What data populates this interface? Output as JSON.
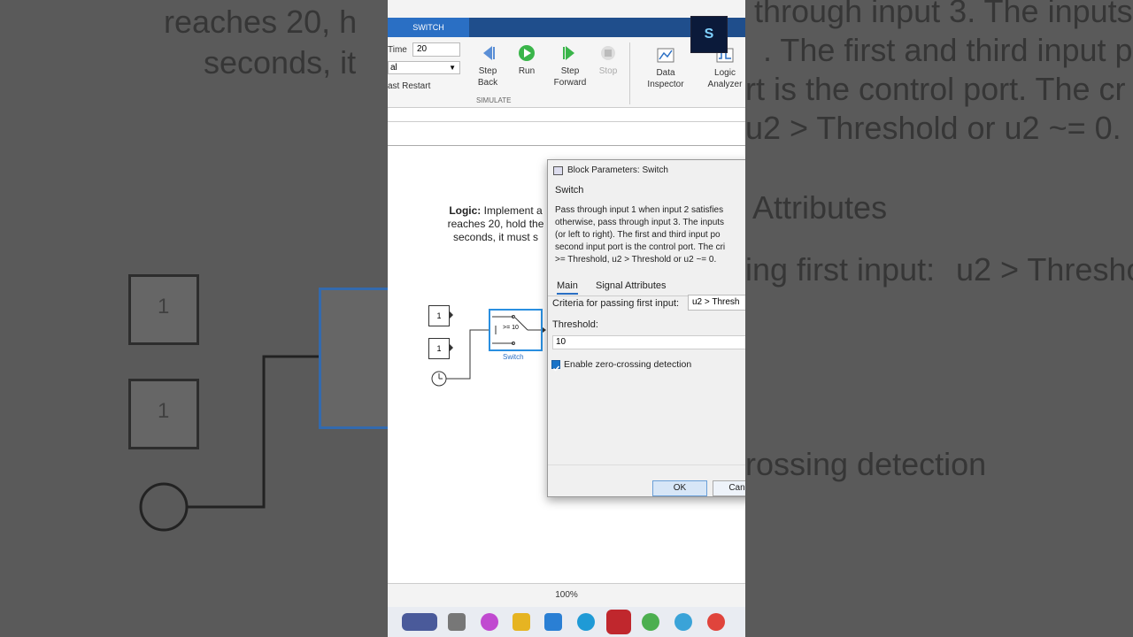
{
  "background": {
    "left_text": [
      "reaches 20, h",
      "seconds, it"
    ],
    "left_blocks": [
      "1",
      "1"
    ],
    "right_text": [
      "through input 3. The inputs",
      ". The first and third input po",
      "rt is the control port. The cr",
      "u2 > Threshold or u2 ~= 0."
    ],
    "right_tab": "Attributes",
    "right_criteria_label": "ing first input:",
    "right_criteria_value": "u2 > Thresho",
    "right_check": "rossing detection"
  },
  "ribbon": {
    "tab_label": "SWITCH",
    "stop_time_label": "Time",
    "stop_time_value": "20",
    "mode_value": "al",
    "fast_restart_label": "ast Restart",
    "step_back_label": "Step Back",
    "run_label": "Run",
    "step_forward_label": "Step Forward",
    "stop_label": "Stop",
    "data_inspector_label": "Data Inspector",
    "logic_analyzer_label": "Logic Analyzer",
    "section_label": "SIMULATE",
    "logo_text": "S"
  },
  "canvas": {
    "logic_title": "Logic:",
    "logic_text_1": " Implement a",
    "logic_text_2": "reaches 20, hold the",
    "logic_text_3": "seconds, it must s",
    "const1": "1",
    "const2": "1",
    "switch_label": "Switch",
    "switch_inner": ">= 10"
  },
  "dialog": {
    "title": "Block Parameters: Switch",
    "heading": "Switch",
    "desc_lines": [
      "Pass through input 1 when input 2 satisfies",
      "otherwise, pass through input 3. The inputs",
      "(or left to right). The first and third input po",
      "second input port is the control port. The cri",
      ">= Threshold, u2 > Threshold or u2 ~= 0."
    ],
    "tab_main": "Main",
    "tab_signal": "Signal Attributes",
    "criteria_label": "Criteria for passing first input:",
    "criteria_value": "u2 > Thresh",
    "threshold_label": "Threshold:",
    "threshold_value": "10",
    "zero_crossing_label": "Enable zero-crossing detection",
    "zero_crossing_checked": true,
    "ok_label": "OK",
    "cancel_label": "Canc"
  },
  "status": {
    "zoom": "100%"
  },
  "colors": {
    "accent": "#2a6fc4",
    "tabbar": "#1f4e8c"
  }
}
